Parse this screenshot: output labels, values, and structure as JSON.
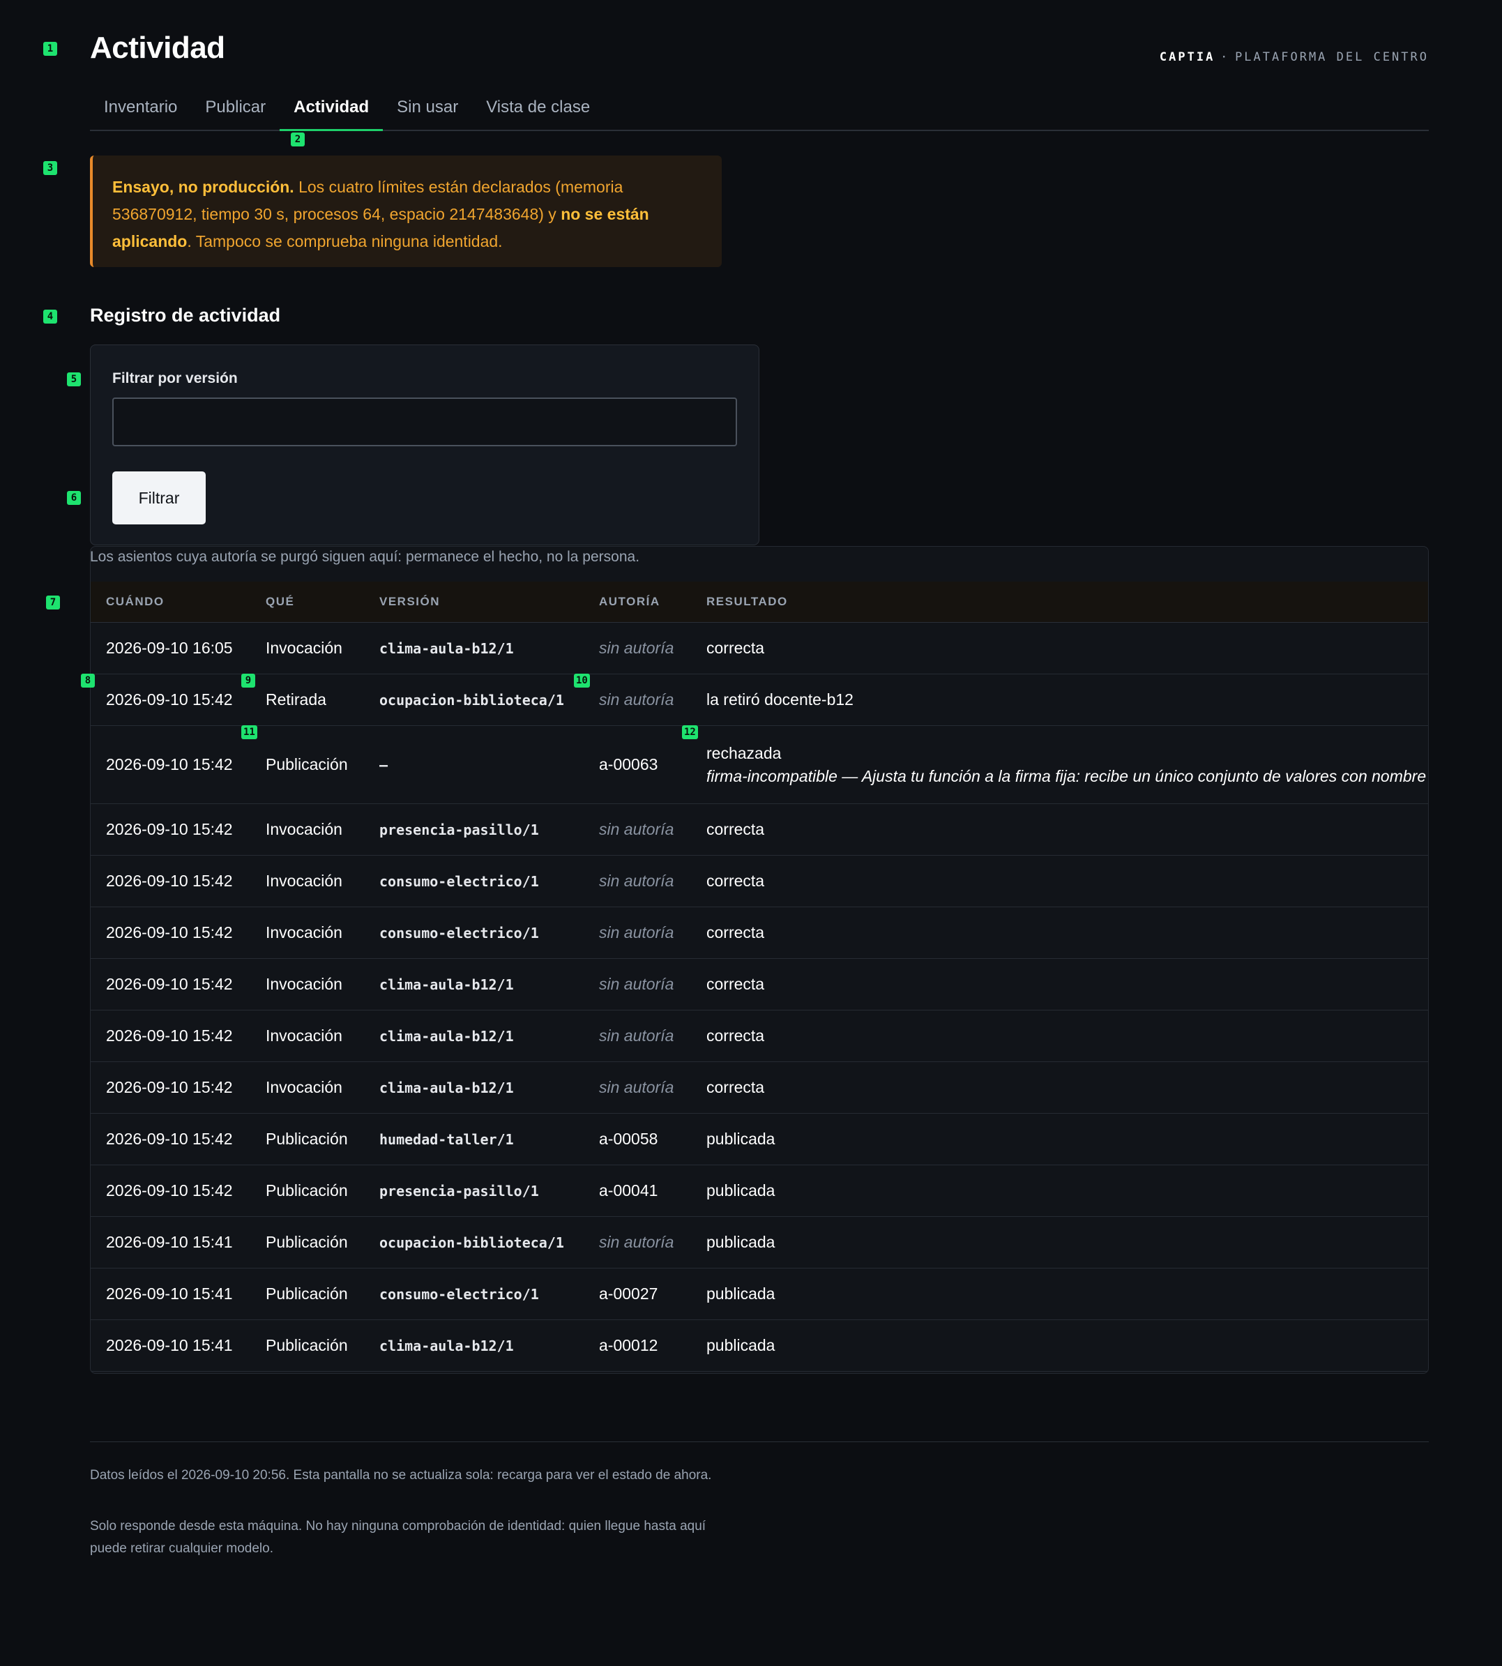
{
  "page": {
    "title": "Actividad"
  },
  "brand": {
    "name": "CAPTIA",
    "separator": "·",
    "subtitle": "PLATAFORMA DEL CENTRO"
  },
  "tabs": [
    {
      "label": "Inventario"
    },
    {
      "label": "Publicar"
    },
    {
      "label": "Actividad",
      "active": true
    },
    {
      "label": "Sin usar"
    },
    {
      "label": "Vista de clase"
    }
  ],
  "warning": {
    "strong1": "Ensayo, no producción.",
    "text1": " Los cuatro límites están declarados (memoria 536870912, tiempo 30 s, procesos 64, espacio 2147483648) y ",
    "strong2": "no se están aplicando",
    "text2": ". Tampoco se comprueba ninguna identidad."
  },
  "section": {
    "title": "Registro de actividad"
  },
  "filter": {
    "label": "Filtrar por versión",
    "value": "",
    "placeholder": "",
    "button": "Filtrar"
  },
  "note": "Los asientos cuya autoría se purgó siguen aquí: permanece el hecho, no la persona.",
  "table": {
    "headers": [
      "CUÁNDO",
      "QUÉ",
      "VERSIÓN",
      "AUTORÍA",
      "RESULTADO"
    ],
    "rows": [
      {
        "when": "2026-09-10 16:05",
        "what": "Invocación",
        "version": "clima-aula-b12/1",
        "author": "sin autoría",
        "result": "correcta"
      },
      {
        "when": "2026-09-10 15:42",
        "what": "Retirada",
        "version": "ocupacion-biblioteca/1",
        "author": "sin autoría",
        "result": "la retiró docente-b12"
      },
      {
        "when": "2026-09-10 15:42",
        "what": "Publicación",
        "version": "–",
        "author": "a-00063",
        "result": "rechazada",
        "detail": "firma-incompatible — Ajusta tu función a la firma fija: recibe un único conjunto de valores con nombre"
      },
      {
        "when": "2026-09-10 15:42",
        "what": "Invocación",
        "version": "presencia-pasillo/1",
        "author": "sin autoría",
        "result": "correcta"
      },
      {
        "when": "2026-09-10 15:42",
        "what": "Invocación",
        "version": "consumo-electrico/1",
        "author": "sin autoría",
        "result": "correcta"
      },
      {
        "when": "2026-09-10 15:42",
        "what": "Invocación",
        "version": "consumo-electrico/1",
        "author": "sin autoría",
        "result": "correcta"
      },
      {
        "when": "2026-09-10 15:42",
        "what": "Invocación",
        "version": "clima-aula-b12/1",
        "author": "sin autoría",
        "result": "correcta"
      },
      {
        "when": "2026-09-10 15:42",
        "what": "Invocación",
        "version": "clima-aula-b12/1",
        "author": "sin autoría",
        "result": "correcta"
      },
      {
        "when": "2026-09-10 15:42",
        "what": "Invocación",
        "version": "clima-aula-b12/1",
        "author": "sin autoría",
        "result": "correcta"
      },
      {
        "when": "2026-09-10 15:42",
        "what": "Publicación",
        "version": "humedad-taller/1",
        "author": "a-00058",
        "result": "publicada"
      },
      {
        "when": "2026-09-10 15:42",
        "what": "Publicación",
        "version": "presencia-pasillo/1",
        "author": "a-00041",
        "result": "publicada"
      },
      {
        "when": "2026-09-10 15:41",
        "what": "Publicación",
        "version": "ocupacion-biblioteca/1",
        "author": "sin autoría",
        "result": "publicada"
      },
      {
        "when": "2026-09-10 15:41",
        "what": "Publicación",
        "version": "consumo-electrico/1",
        "author": "a-00027",
        "result": "publicada"
      },
      {
        "when": "2026-09-10 15:41",
        "what": "Publicación",
        "version": "clima-aula-b12/1",
        "author": "a-00012",
        "result": "publicada"
      }
    ]
  },
  "footer": {
    "line1": "Datos leídos el 2026-09-10 20:56. Esta pantalla no se actualiza sola: recarga para ver el estado de ahora.",
    "line2": "Solo responde desde esta máquina. No hay ninguna comprobación de identidad: quien llegue hasta aquí puede retirar cualquier modelo."
  },
  "markers": [
    "1",
    "2",
    "3",
    "4",
    "5",
    "6",
    "7",
    "8",
    "9",
    "10",
    "11",
    "12"
  ],
  "colors": {
    "accent": "#1ecf6a",
    "warning": "#f0a52f",
    "background": "#0c0e12",
    "marker": "#1ee36f"
  }
}
